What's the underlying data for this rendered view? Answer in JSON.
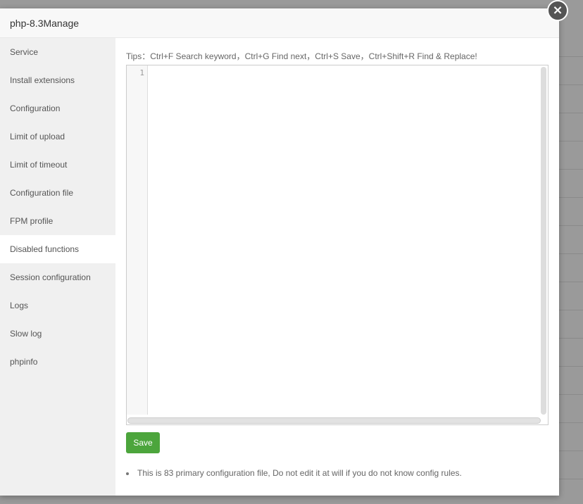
{
  "dialog": {
    "title": "php-8.3Manage"
  },
  "sidebar": {
    "items": [
      {
        "label": "Service"
      },
      {
        "label": "Install extensions"
      },
      {
        "label": "Configuration"
      },
      {
        "label": "Limit of upload"
      },
      {
        "label": "Limit of timeout"
      },
      {
        "label": "Configuration file"
      },
      {
        "label": "FPM profile"
      },
      {
        "label": "Disabled functions",
        "active": true
      },
      {
        "label": "Session configuration"
      },
      {
        "label": "Logs"
      },
      {
        "label": "Slow log"
      },
      {
        "label": "phpinfo"
      }
    ]
  },
  "main": {
    "tips": "Tips：Ctrl+F Search keyword，Ctrl+G Find next，Ctrl+S Save，Ctrl+Shift+R Find & Replace!",
    "line_number": "1",
    "save_label": "Save",
    "note": "This is 83 primary configuration file, Do not edit it at will if you do not know config rules."
  },
  "colors": {
    "accent": "#4ca53c"
  }
}
